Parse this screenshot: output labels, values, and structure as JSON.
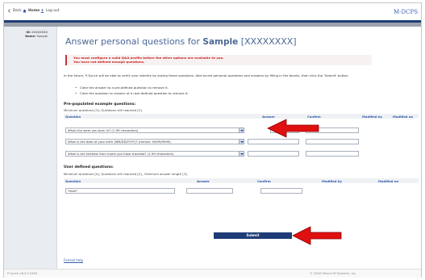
{
  "topbar": {
    "back_label": "Back",
    "home_label": "Home",
    "logout_label": "Log out",
    "brand": "M-DCPS"
  },
  "sidebar": {
    "id_label": "ID:",
    "id_value": "XXXXXXXX",
    "name_label": "Name:",
    "name_value": "Sample"
  },
  "page": {
    "title_prefix": "Answer personal questions for",
    "title_name": "Sample",
    "title_id": "[XXXXXXXX]"
  },
  "warning": {
    "line1": "You must configure a valid Q&A profile before the other options are available to you.",
    "line2": "You have not defined enough questions."
  },
  "intro": "In the future, P-Synch will be able to verify your identity by asking these questions. Add secret personal questions and answers by filling in the blanks, then click the 'Submit' button.",
  "bullets": [
    "Clear the answer to a pre-defined question to remove it.",
    "Clear the question or answer of a user-defined question to remove it."
  ],
  "prepopulated": {
    "heading": "Pre-populated example questions:",
    "subtext": "Minimum questions [3], Questions still required [3]",
    "columns": [
      "Question",
      "Answer",
      "Confirm",
      "Modified by",
      "Modified on"
    ],
    "rows": [
      {
        "question": "What city were you born in? (1-99 characters)"
      },
      {
        "question": "What is the date of your birth (MM/DD/YYYY)? (format: 99/99/9999)"
      },
      {
        "question": "What is the farthest from home you have traveled? (1-99 characters)"
      }
    ]
  },
  "userdefined": {
    "heading": "User defined questions:",
    "subtext": "Minimum questions [0], Questions still required [0] , Minimum answer length [3]",
    "columns": [
      "Question",
      "Answer",
      "Confirm",
      "Modified by",
      "Modified on"
    ],
    "row": {
      "question_value": "*new*"
    }
  },
  "submit_label": "Submit",
  "format_help_label": "Format help",
  "footer": {
    "version": "P-Synch v6.4.0.2483",
    "copyright": "© 2004 Hitachi ID Systems, Inc."
  },
  "colors": {
    "accent": "#1e3c77",
    "title": "#4a6795",
    "warning": "#cc2222",
    "annotation_arrow": "#e01010"
  }
}
